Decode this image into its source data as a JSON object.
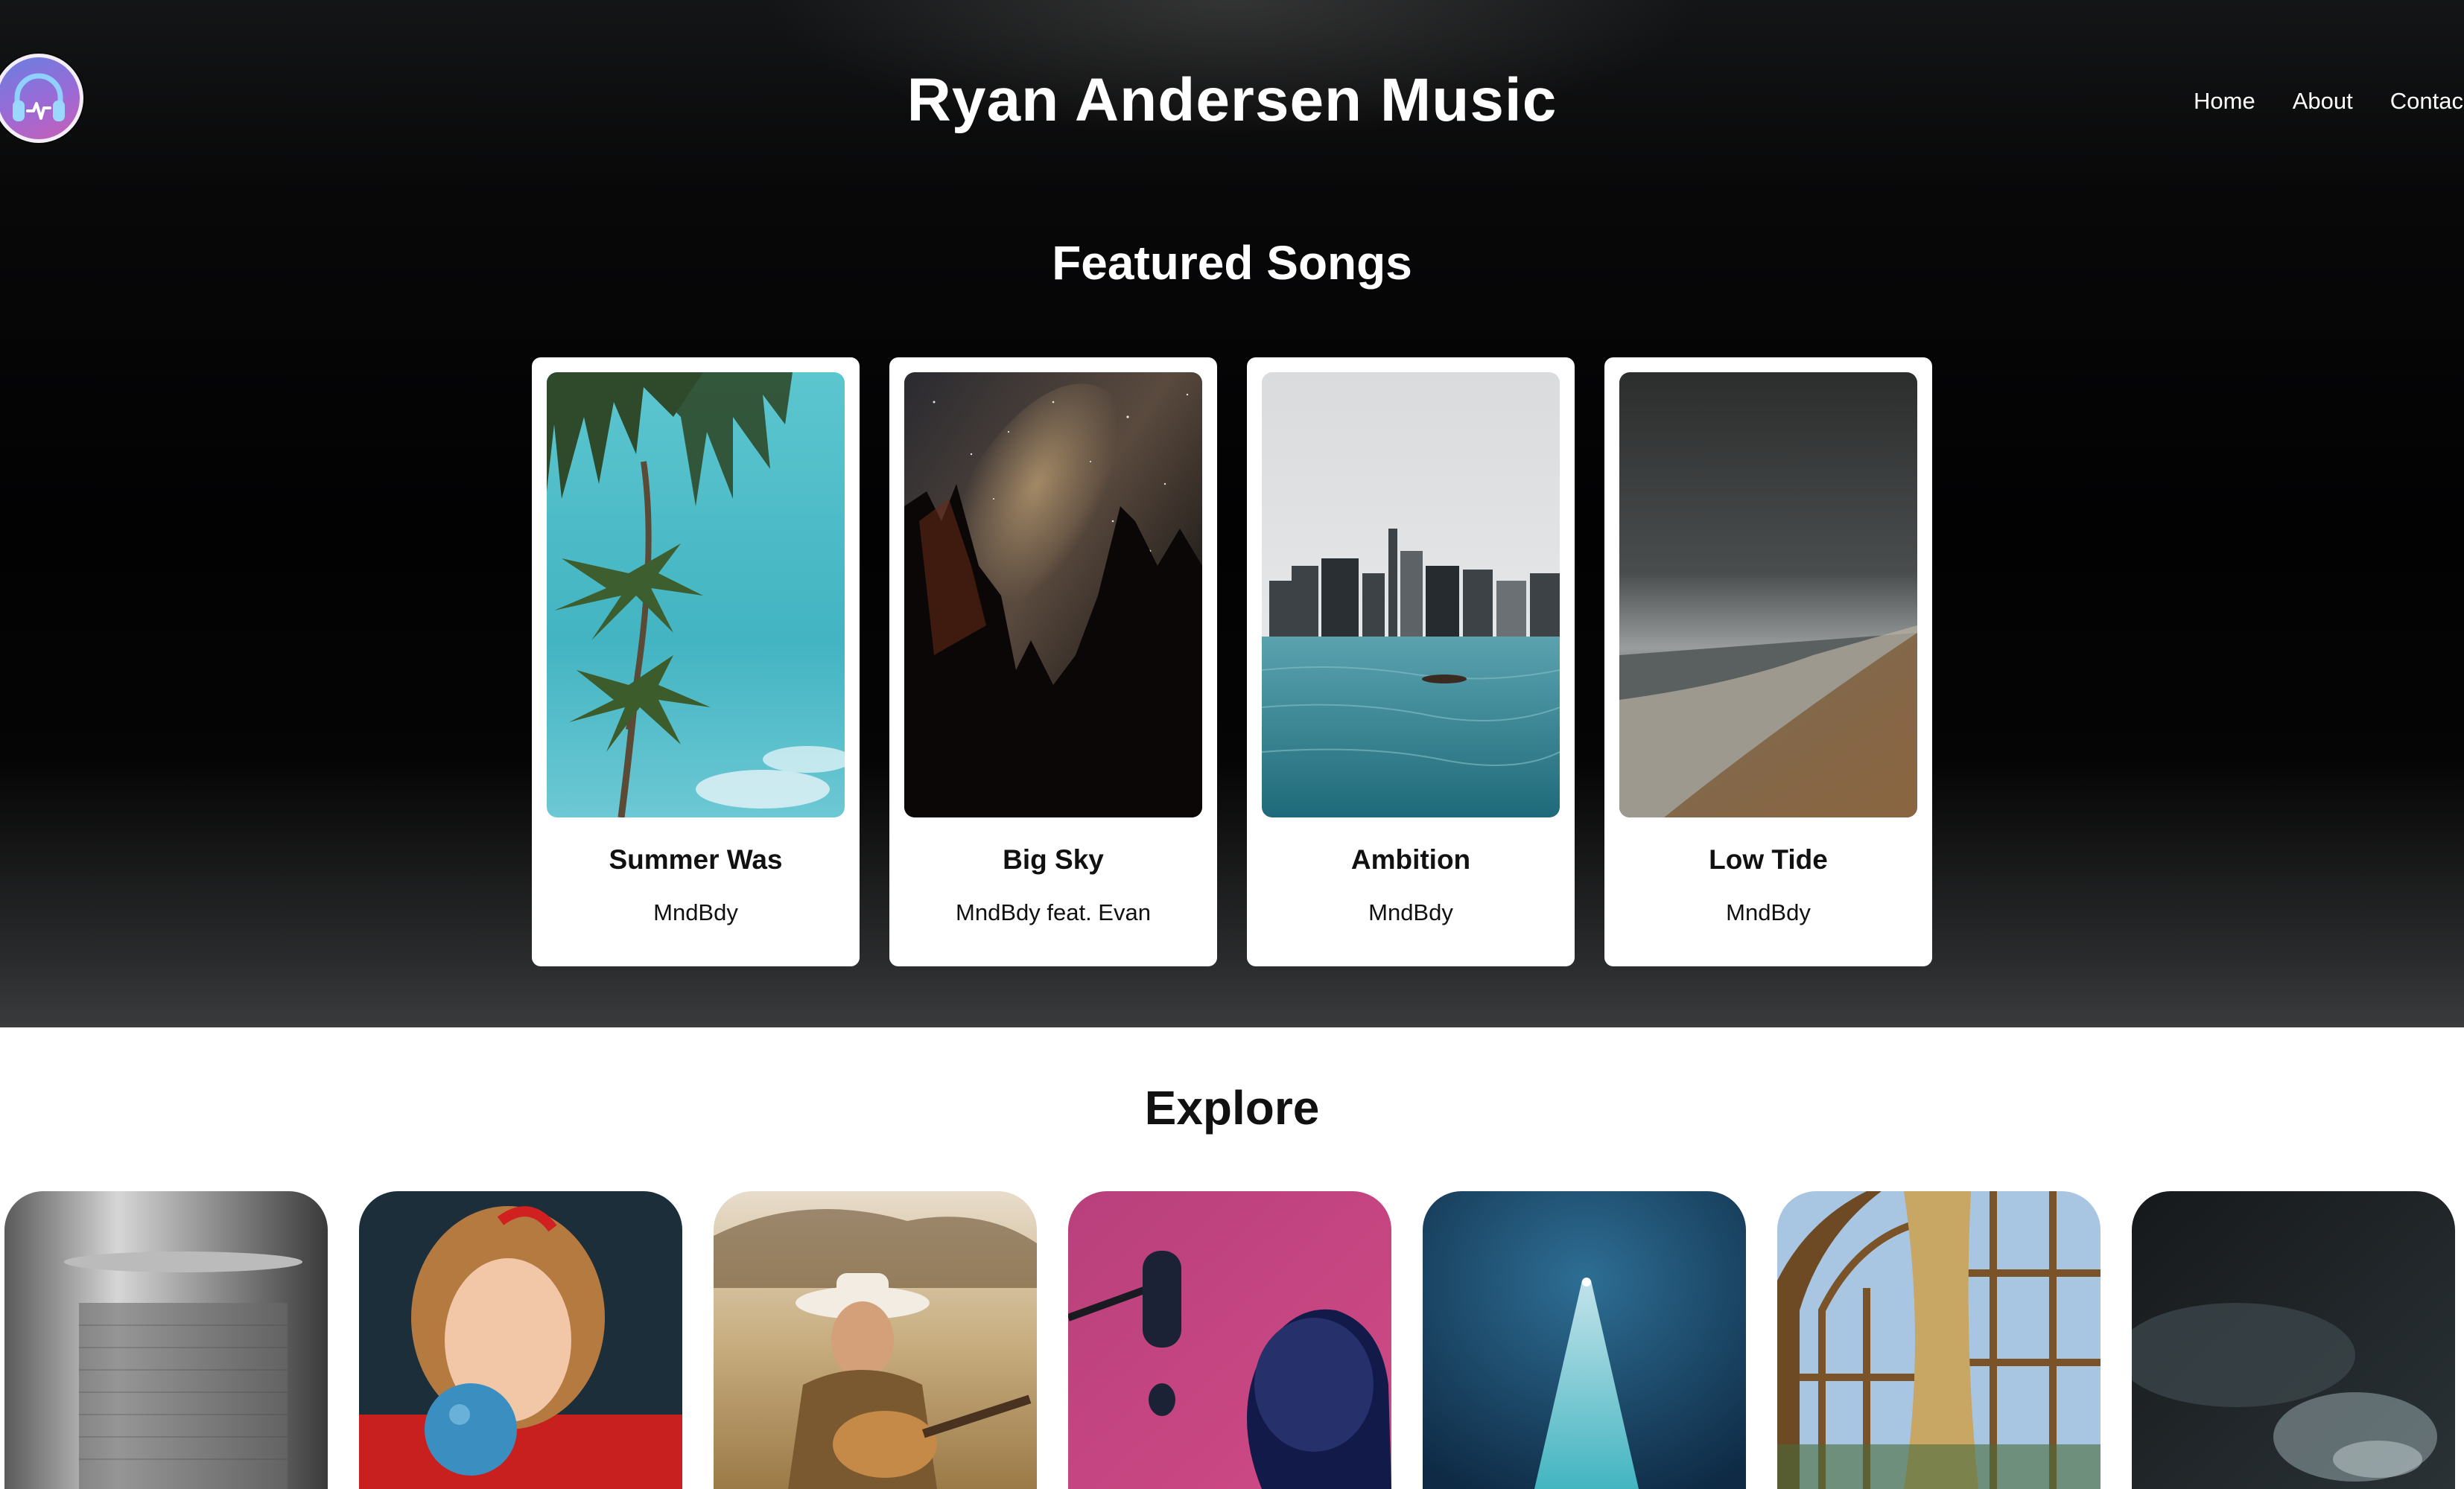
{
  "header": {
    "logo_icon": "headphones-pulse-icon",
    "title": "Ryan Andersen Music",
    "nav": [
      "Home",
      "About",
      "Contac"
    ]
  },
  "featured": {
    "heading": "Featured Songs",
    "songs": [
      {
        "title": "Summer Was",
        "artist": "MndBdy",
        "image": "palm-trees-sky"
      },
      {
        "title": "Big Sky",
        "artist": "MndBdy feat. Evan",
        "image": "milky-way-forest"
      },
      {
        "title": "Ambition",
        "artist": "MndBdy",
        "image": "infinity-pool-city"
      },
      {
        "title": "Low Tide",
        "artist": "MndBdy",
        "image": "stormy-beach"
      }
    ]
  },
  "explore": {
    "heading": "Explore",
    "tiles": [
      "microphone-closeup",
      "woman-bubblegum",
      "cowgirl-guitar",
      "singer-studio-mic",
      "spotlight-beam",
      "arched-window-curtains",
      "dark-clouds"
    ]
  },
  "colors": {
    "hero_dark": "#020203",
    "hero_bottom": "#3a3b3c",
    "logo_gradient": [
      "#6a7fe0",
      "#c85fb6"
    ],
    "card_bg": "#ffffff"
  }
}
